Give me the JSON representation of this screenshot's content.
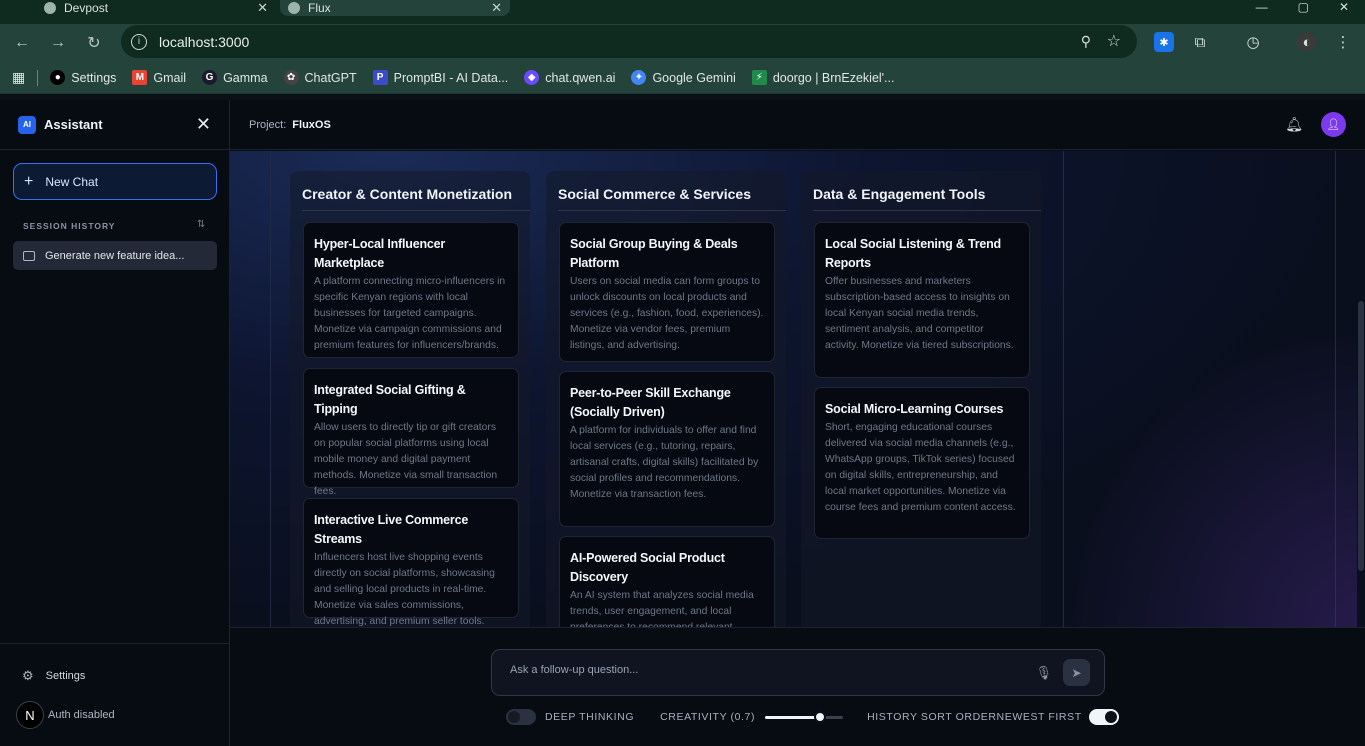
{
  "browser": {
    "tabs": [
      {
        "label": "Devpost"
      },
      {
        "label": "Flux"
      }
    ],
    "url": "localhost:3000",
    "bookmarks": [
      {
        "label": "Settings",
        "icon": "github-icon",
        "color": "#000000"
      },
      {
        "label": "Gmail",
        "icon": "gmail-icon",
        "color": "#ea4335"
      },
      {
        "label": "Gamma",
        "icon": "gamma-icon",
        "color": "#1a1a2e"
      },
      {
        "label": "ChatGPT",
        "icon": "chatgpt-icon",
        "color": "#10a37f"
      },
      {
        "label": "PromptBI - AI Data...",
        "icon": "promptbi-icon",
        "color": "#3b4cca"
      },
      {
        "label": "chat.qwen.ai",
        "icon": "qwen-icon",
        "color": "#6a4cff"
      },
      {
        "label": "Google Gemini",
        "icon": "gemini-icon",
        "color": "#4285f4"
      },
      {
        "label": "doorgo | BrnEzekiel'...",
        "icon": "doorgo-icon",
        "color": "#1f8a4c"
      }
    ]
  },
  "sidebar": {
    "logo_text": "AI",
    "title": "Assistant",
    "new_chat_label": "New Chat",
    "session_history_label": "SESSION HISTORY",
    "sessions": [
      {
        "label": "Generate new feature idea..."
      }
    ],
    "settings_label": "Settings",
    "auth_initial": "N",
    "auth_label": "Auth disabled"
  },
  "topbar": {
    "project_label": "Project:",
    "project_name": "FluxOS"
  },
  "board": {
    "columns": [
      {
        "title": "Creator & Content Monetization",
        "cards": [
          {
            "title": "Hyper-Local Influencer Marketplace",
            "desc": "A platform connecting micro-influencers in specific Kenyan regions with local businesses for targeted campaigns. Monetize via campaign commissions and premium features for influencers/brands."
          },
          {
            "title": "Integrated Social Gifting & Tipping",
            "desc": "Allow users to directly tip or gift creators on popular social platforms using local mobile money and digital payment methods. Monetize via small transaction fees."
          },
          {
            "title": "Interactive Live Commerce Streams",
            "desc": "Influencers host live shopping events directly on social platforms, showcasing and selling local products in real-time. Monetize via sales commissions, advertising, and premium seller tools."
          }
        ]
      },
      {
        "title": "Social Commerce & Services",
        "cards": [
          {
            "title": "Social Group Buying & Deals Platform",
            "desc": "Users on social media can form groups to unlock discounts on local products and services (e.g., fashion, food, experiences). Monetize via vendor fees, premium listings, and advertising."
          },
          {
            "title": "Peer-to-Peer Skill Exchange (Socially Driven)",
            "desc": "A platform for individuals to offer and find local services (e.g., tutoring, repairs, artisanal crafts, digital skills) facilitated by social profiles and recommendations. Monetize via transaction fees."
          },
          {
            "title": "AI-Powered Social Product Discovery",
            "desc": "An AI system that analyzes social media trends, user engagement, and local preferences to recommend relevant"
          }
        ]
      },
      {
        "title": "Data & Engagement Tools",
        "cards": [
          {
            "title": "Local Social Listening & Trend Reports",
            "desc": "Offer businesses and marketers subscription-based access to insights on local Kenyan social media trends, sentiment analysis, and competitor activity. Monetize via tiered subscriptions."
          },
          {
            "title": "Social Micro-Learning Courses",
            "desc": "Short, engaging educational courses delivered via social media channels (e.g., WhatsApp groups, TikTok series) focused on digital skills, entrepreneurship, and local market opportunities. Monetize via course fees and premium content access."
          }
        ]
      }
    ]
  },
  "composer": {
    "placeholder": "Ask a follow-up question...",
    "deep_thinking_label": "DEEP THINKING",
    "deep_thinking_on": false,
    "creativity_label": "CREATIVITY (0.7)",
    "creativity_value": 0.7,
    "history_sort_label": "HISTORY SORT ORDER",
    "history_sort_value": "NEWEST FIRST",
    "history_sort_on": true
  },
  "colors": {
    "accent": "#2563eb",
    "avatar": "#7c3aed",
    "browser_frame": "#24433a"
  }
}
